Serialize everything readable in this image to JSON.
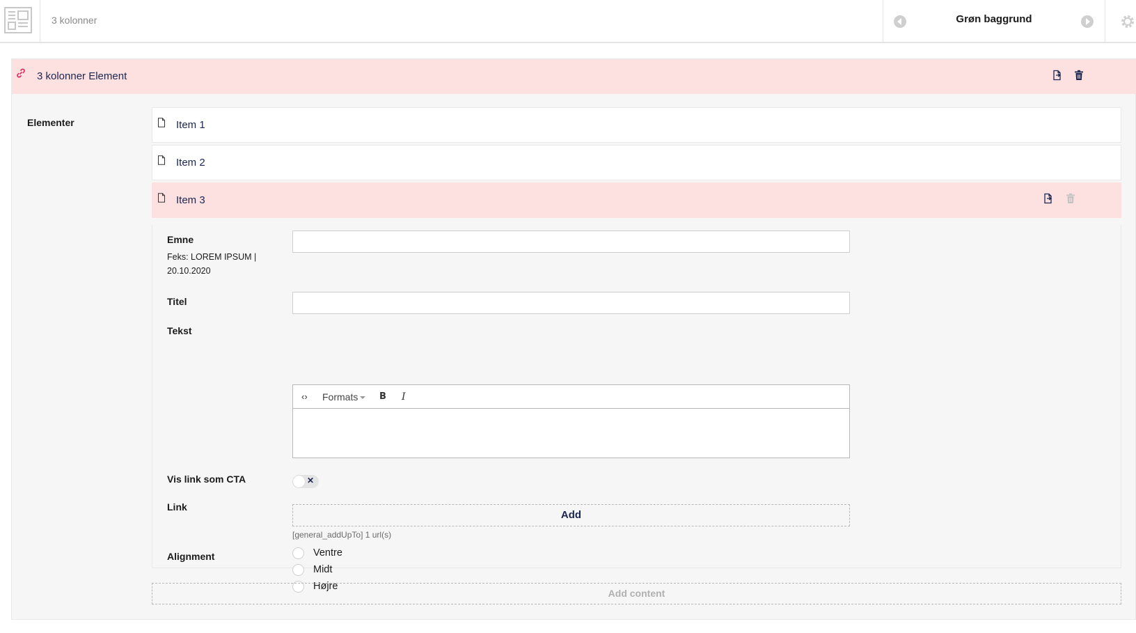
{
  "topbar": {
    "layout_name": "3 kolonner",
    "variant_name": "Grøn baggrund"
  },
  "block": {
    "title": "3 kolonner Element",
    "property_label": "Elementer",
    "items": [
      {
        "label": "Item 1"
      },
      {
        "label": "Item 2"
      },
      {
        "label": "Item 3"
      }
    ],
    "add_content_label": "Add content"
  },
  "editor": {
    "emne": {
      "label": "Emne",
      "description": "Feks: LOREM IPSUM | 20.10.2020",
      "value": ""
    },
    "titel": {
      "label": "Titel",
      "value": ""
    },
    "tekst": {
      "label": "Tekst",
      "toolbar": {
        "code": "‹›",
        "formats": "Formats",
        "bold": "B",
        "italic": "I"
      },
      "value": ""
    },
    "cta": {
      "label": "Vis link som CTA",
      "toggle_symbol": "✕",
      "checked": false
    },
    "link": {
      "label": "Link",
      "add_label": "Add",
      "hint": "[general_addUpTo] 1 url(s)"
    },
    "alignment": {
      "label": "Alignment",
      "options": [
        "Ventre",
        "Midt",
        "Højre"
      ]
    }
  },
  "colors": {
    "active_bg": "#fde1e1",
    "panel_bg": "#f6f6f6",
    "text_primary": "#1b264f",
    "link_icon": "#e0245e"
  },
  "icons": [
    "layout-icon",
    "chevron-left-icon",
    "chevron-right-icon",
    "gear-icon",
    "link-icon",
    "copy-icon",
    "trash-icon",
    "document-icon"
  ]
}
